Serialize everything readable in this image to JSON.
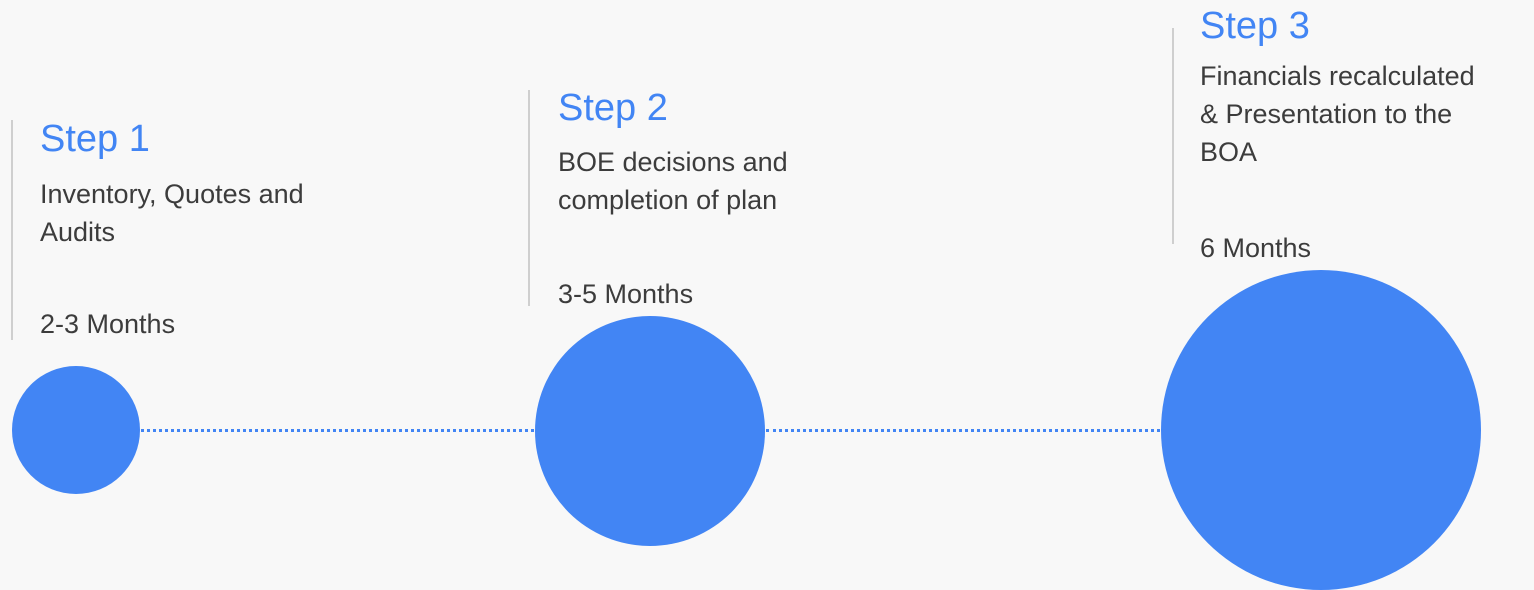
{
  "accent_color": "#4285f4",
  "steps": [
    {
      "title": "Step 1",
      "description_lines": [
        "Inventory, Quotes and",
        "Audits"
      ],
      "duration": "2-3 Months"
    },
    {
      "title": "Step 2",
      "description_lines": [
        "BOE decisions and",
        "completion of plan"
      ],
      "duration": "3-5 Months"
    },
    {
      "title": "Step 3",
      "description_lines": [
        "Financials recalculated",
        "& Presentation to the",
        "BOA"
      ],
      "duration": "6 Months"
    }
  ]
}
